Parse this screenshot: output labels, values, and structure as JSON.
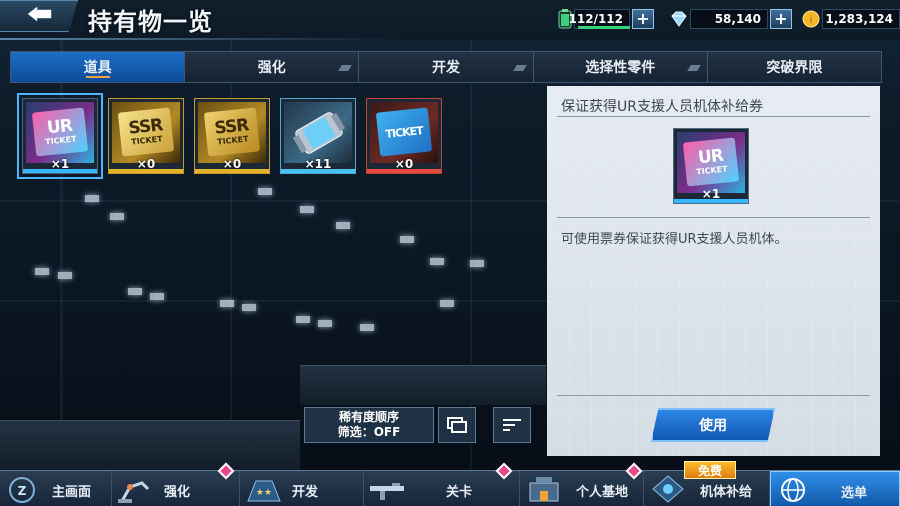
{
  "header": {
    "title": "持有物一览",
    "energy": "112/112",
    "energy_fill_fraction": 1.0,
    "crystal": "58,140",
    "coins": "1,283,124"
  },
  "tabs": [
    {
      "label": "道具",
      "active": true
    },
    {
      "label": "强化",
      "active": false
    },
    {
      "label": "开发",
      "active": false
    },
    {
      "label": "选择性零件",
      "active": false
    },
    {
      "label": "突破界限",
      "active": false
    }
  ],
  "items": [
    {
      "name": "ur-ticket",
      "art_big": "UR",
      "art_small": "TICKET",
      "count": "×1",
      "selected": true,
      "rarity_color": "#35b8ff"
    },
    {
      "name": "ssr-ticket-a",
      "art_big": "SSR",
      "art_small": "TICKET",
      "count": "×0",
      "selected": false,
      "rarity_color": "#e6b22a"
    },
    {
      "name": "ssr-ticket-b",
      "art_big": "SSR",
      "art_small": "TICKET",
      "count": "×0",
      "selected": false,
      "rarity_color": "#e6b22a"
    },
    {
      "name": "capsule",
      "art_big": "",
      "art_small": "",
      "count": "×11",
      "selected": false,
      "rarity_color": "#49c0f0"
    },
    {
      "name": "ticket",
      "art_big": "TICKET",
      "art_small": "",
      "count": "×0",
      "selected": false,
      "rarity_color": "#e54b40"
    }
  ],
  "sort": {
    "order_label": "稀有度顺序",
    "filter_label": "筛选：OFF"
  },
  "detail": {
    "title": "保证获得UR支援人员机体补给券",
    "icon_big": "UR",
    "icon_small": "TICKET",
    "icon_count": "×1",
    "description": "可使用票券保证获得UR支援人员机体。",
    "use_label": "使用"
  },
  "nav": {
    "items": [
      {
        "label": "主画面"
      },
      {
        "label": "强化"
      },
      {
        "label": "开发"
      },
      {
        "label": "关卡"
      },
      {
        "label": "个人基地"
      },
      {
        "label": "机体补给"
      },
      {
        "label": "选单"
      }
    ],
    "free_badge": "免费"
  }
}
